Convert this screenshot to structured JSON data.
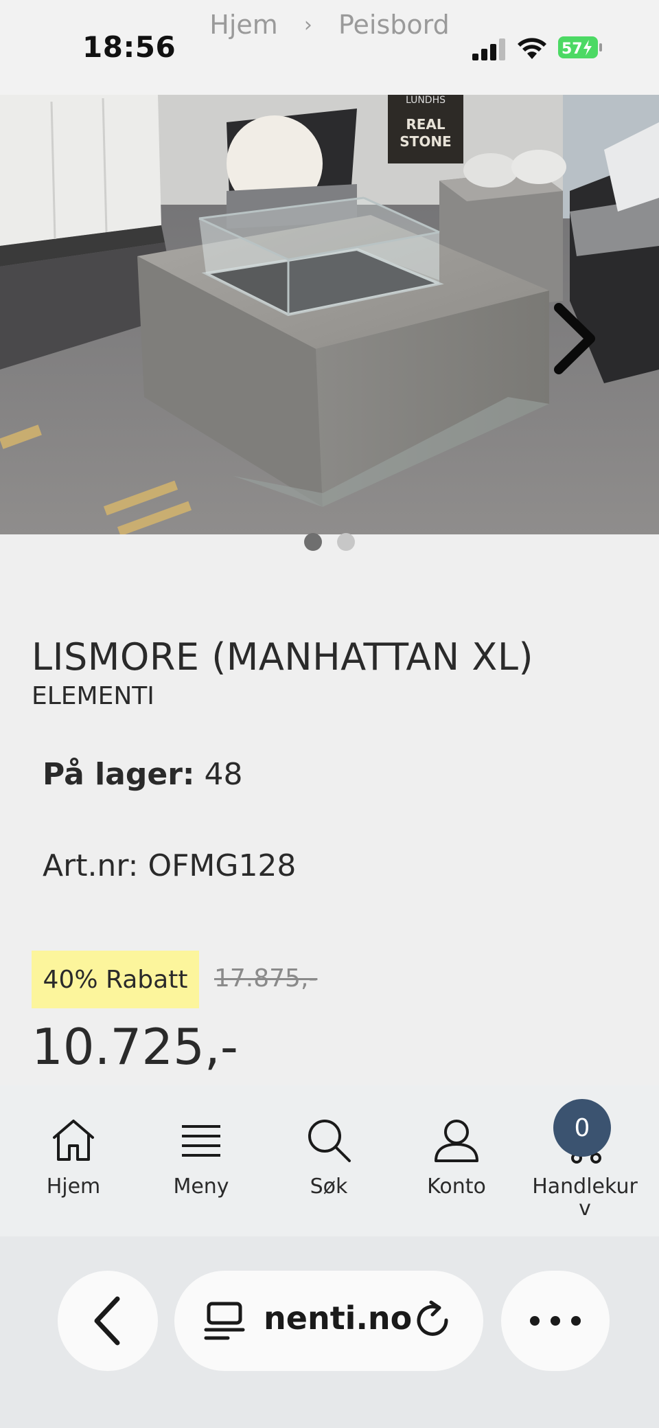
{
  "status": {
    "time": "18:56",
    "battery": "57"
  },
  "breadcrumb": {
    "home": "Hjem",
    "separator": "›",
    "current": "Peisbord"
  },
  "hero": {
    "carousel_total": 2,
    "carousel_active": 1,
    "sign_text_top": "LUNDHS",
    "sign_text_line1": "REAL",
    "sign_text_line2": "STONE"
  },
  "product": {
    "title": "LISMORE (MANHATTAN XL)",
    "brand": "ELEMENTI",
    "stock_label": "På lager:",
    "stock_value": "48",
    "artnr": "Art.nr: OFMG128",
    "discount": "40% Rabatt",
    "old_price": "17.875,-",
    "price": "10.725,-"
  },
  "nav": {
    "home": "Hjem",
    "menu": "Meny",
    "search": "Søk",
    "account": "Konto",
    "cart_line1": "Handlekur",
    "cart_line2": "v",
    "cart_count": "0"
  },
  "browser": {
    "url": "nenti.no"
  },
  "colors": {
    "badge_yellow": "#fcf59c",
    "cart_badge": "#3b5370",
    "battery_green": "#4cd964"
  }
}
